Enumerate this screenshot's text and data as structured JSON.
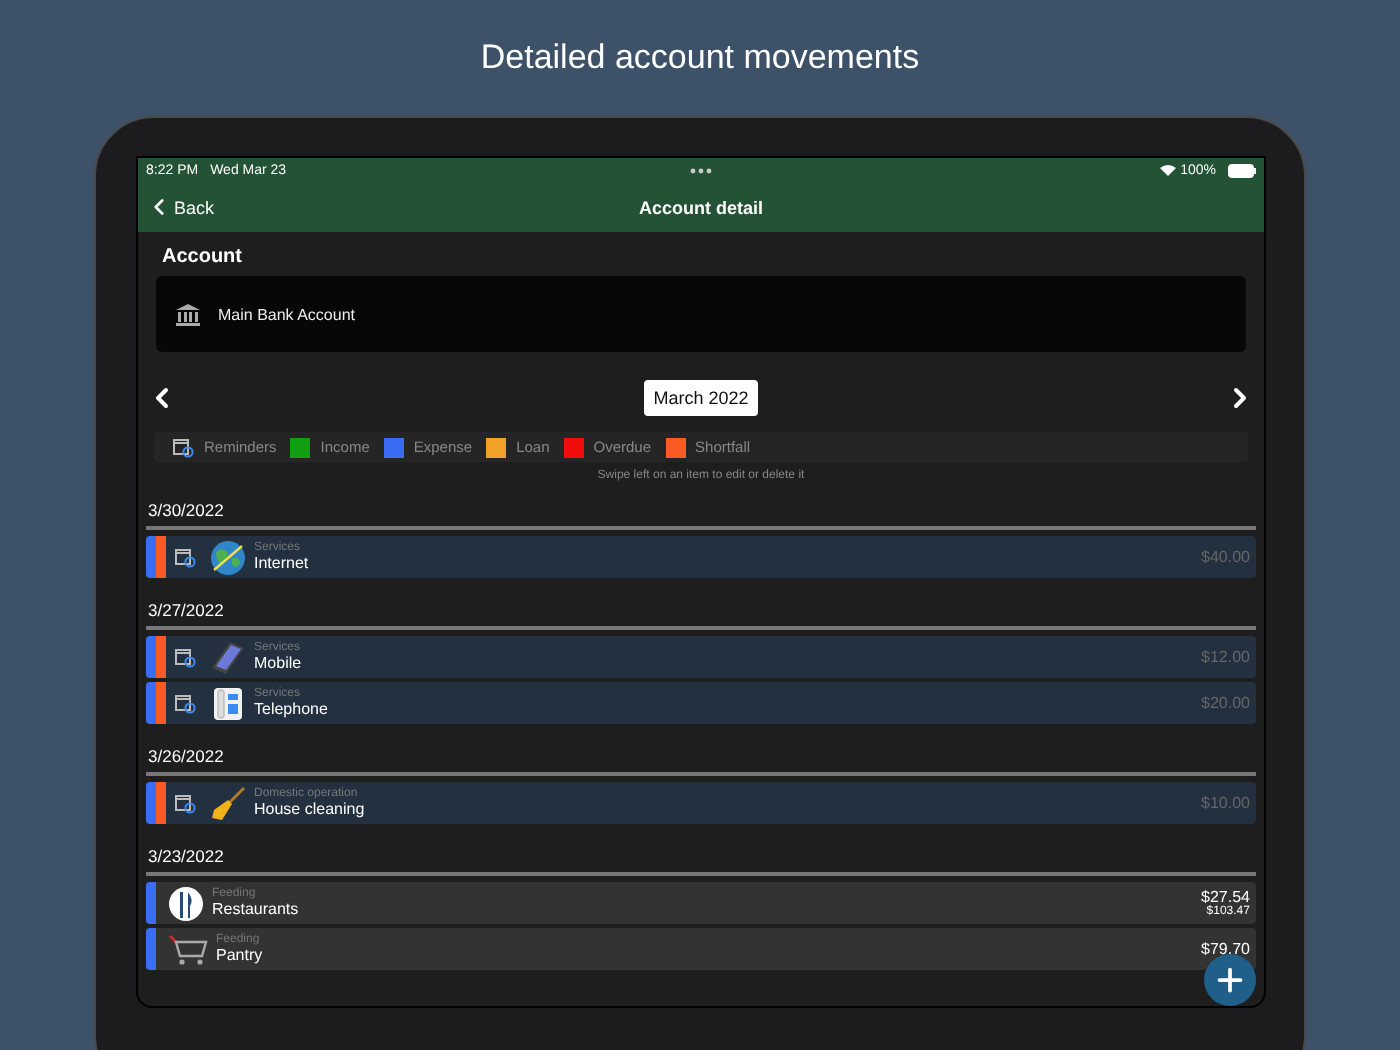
{
  "heading": "Detailed account movements",
  "status_bar": {
    "time": "8:22 PM",
    "date": "Wed Mar 23",
    "battery": "100%"
  },
  "nav": {
    "back": "Back",
    "title": "Account detail"
  },
  "account": {
    "label": "Account",
    "name": "Main Bank Account"
  },
  "month": {
    "value": "March 2022"
  },
  "legend": [
    {
      "label": "Reminders",
      "kind": "reminder"
    },
    {
      "label": "Income",
      "kind": "swatch",
      "color": "#11a011"
    },
    {
      "label": "Expense",
      "kind": "swatch",
      "color": "#3a6cf4"
    },
    {
      "label": "Loan",
      "kind": "swatch",
      "color": "#f4a12a"
    },
    {
      "label": "Overdue",
      "kind": "swatch",
      "color": "#f20d0d"
    },
    {
      "label": "Shortfall",
      "kind": "swatch",
      "color": "#fa5a24"
    }
  ],
  "hint": "Swipe left on an item to edit or delete it",
  "groups": [
    {
      "date": "3/30/2022",
      "items": [
        {
          "kind": "globe",
          "category": "Services",
          "name": "Internet",
          "amount": "$40.00",
          "reminder": true,
          "stripes": [
            {
              "color": "#3a6cf4"
            },
            {
              "color": "#fa5a24"
            }
          ]
        }
      ]
    },
    {
      "date": "3/27/2022",
      "items": [
        {
          "kind": "mobile",
          "category": "Services",
          "name": "Mobile",
          "amount": "$12.00",
          "reminder": true,
          "stripes": [
            {
              "color": "#3a6cf4"
            },
            {
              "color": "#fa5a24"
            }
          ]
        },
        {
          "kind": "desk-phone",
          "category": "Services",
          "name": "Telephone",
          "amount": "$20.00",
          "reminder": true,
          "stripes": [
            {
              "color": "#3a6cf4"
            },
            {
              "color": "#fa5a24"
            }
          ]
        }
      ]
    },
    {
      "date": "3/26/2022",
      "items": [
        {
          "kind": "broom",
          "category": "Domestic operation",
          "name": "House cleaning",
          "amount": "$10.00",
          "reminder": true,
          "stripes": [
            {
              "color": "#3a6cf4"
            },
            {
              "color": "#fa5a24"
            }
          ]
        }
      ]
    },
    {
      "date": "3/23/2022",
      "items": [
        {
          "kind": "cutlery",
          "category": "Feeding",
          "name": "Restaurants",
          "amount": "$27.54",
          "balance": "$103.47",
          "reminder": false,
          "stripes": [
            {
              "color": "#3a6cf4"
            }
          ]
        },
        {
          "kind": "cart",
          "category": "Feeding",
          "name": "Pantry",
          "amount": "$79.70",
          "reminder": false,
          "stripes": [
            {
              "color": "#3a6cf4"
            }
          ]
        }
      ]
    }
  ]
}
